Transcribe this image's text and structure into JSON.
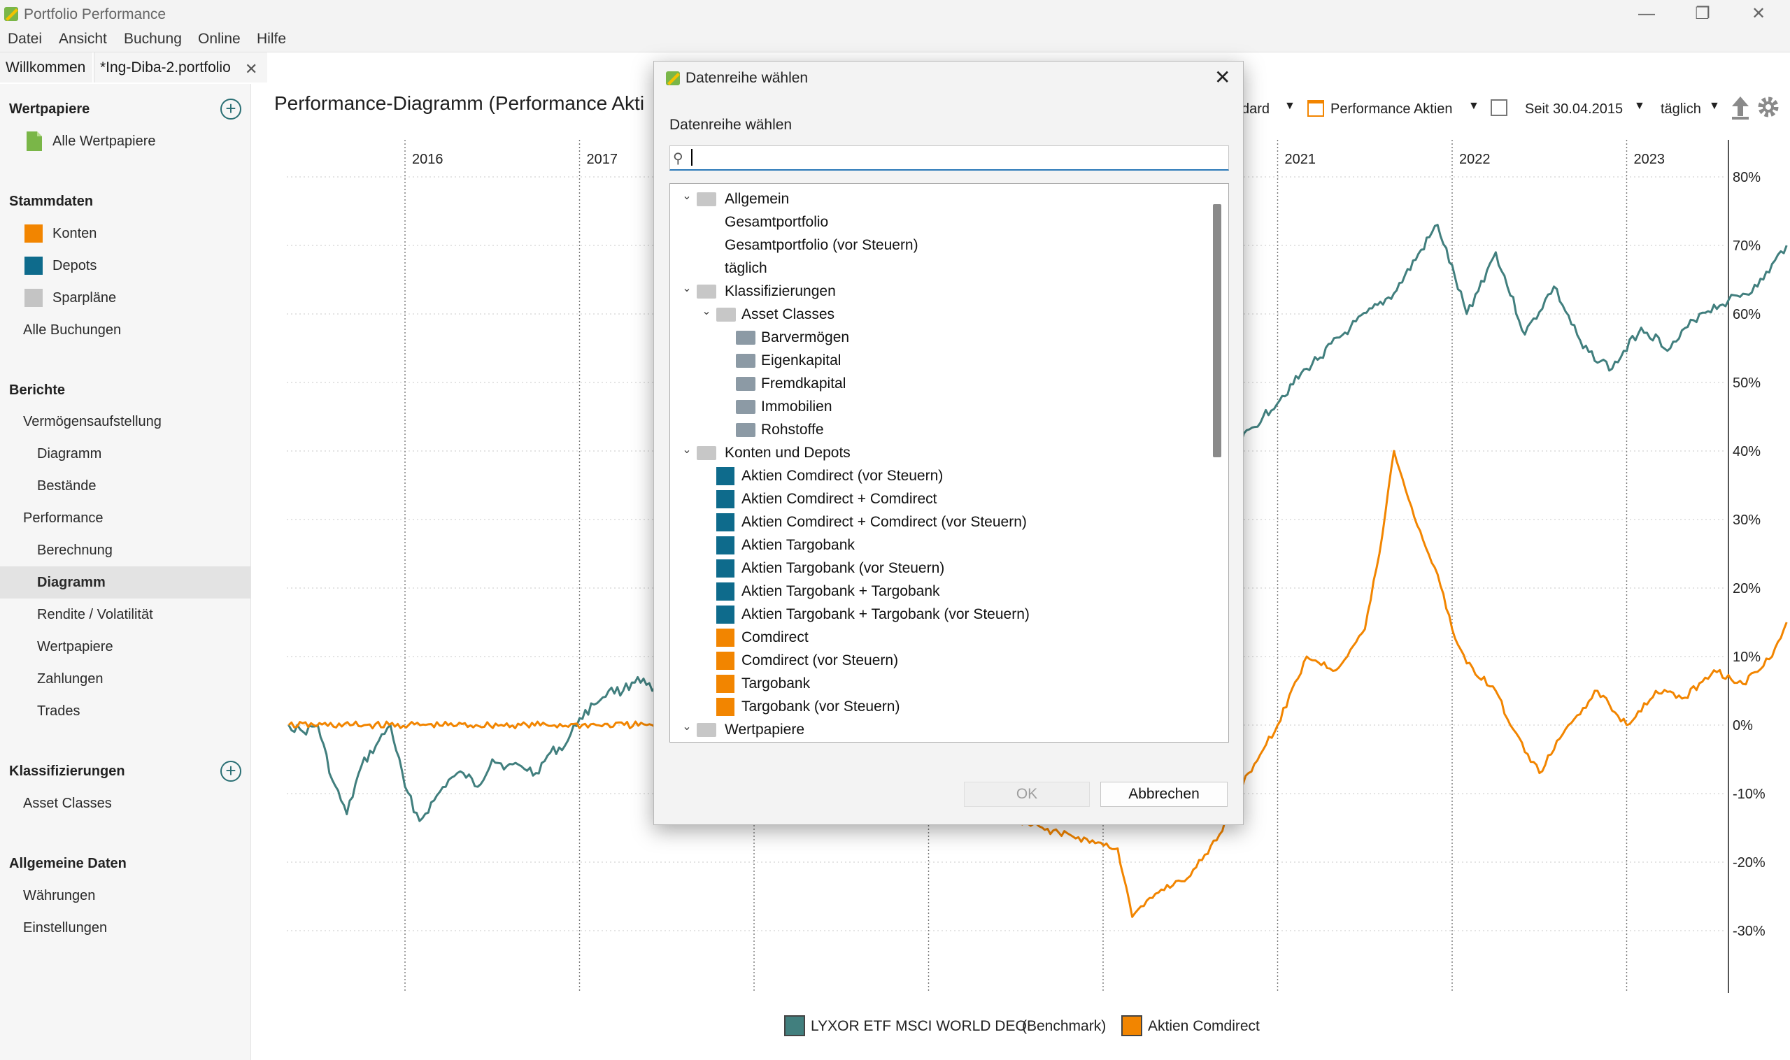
{
  "app": {
    "title": "Portfolio Performance"
  },
  "window": {
    "minimize": "—",
    "restore": "❐",
    "close": "✕"
  },
  "menu": [
    "Datei",
    "Ansicht",
    "Buchung",
    "Online",
    "Hilfe"
  ],
  "tabs": {
    "welcome": "Willkommen",
    "file": "*Ing-Diba-2.portfolio",
    "close": "✕"
  },
  "sidebar": {
    "wertpapiere": {
      "head": "Wertpapiere",
      "items": [
        "Alle Wertpapiere"
      ]
    },
    "stammdaten": {
      "head": "Stammdaten",
      "items": [
        "Konten",
        "Depots",
        "Sparpläne",
        "Alle Buchungen"
      ]
    },
    "berichte": {
      "head": "Berichte",
      "items": [
        "Vermögensaufstellung",
        "Diagramm",
        "Bestände",
        "Performance",
        "Berechnung",
        "Diagramm",
        "Rendite / Volatilität",
        "Wertpapiere",
        "Zahlungen",
        "Trades"
      ]
    },
    "klassifizierungen": {
      "head": "Klassifizierungen",
      "items": [
        "Asset Classes"
      ]
    },
    "allgemein": {
      "head": "Allgemeine Daten",
      "items": [
        "Währungen",
        "Einstellungen"
      ]
    },
    "active": "Diagramm"
  },
  "chart_header": {
    "title": "Performance-Diagramm (Performance Akti",
    "view_partial": "dard",
    "view_name": "Performance Aktien",
    "period": "Seit 30.04.2015",
    "interval": "täglich"
  },
  "colors": {
    "benchmark": "#417f7e",
    "aktien": "#f28500",
    "accent": "#2a6f74"
  },
  "chart_data": {
    "type": "line",
    "x_years": [
      "2016",
      "2017",
      "2021",
      "2022",
      "2023"
    ],
    "yticks": [
      "80%",
      "70%",
      "60%",
      "50%",
      "40%",
      "30%",
      "20%",
      "10%",
      "0%",
      "-10%",
      "-20%",
      "-30%"
    ],
    "ylim": [
      -30,
      80
    ],
    "grid": true,
    "legend_position": "bottom",
    "series": [
      {
        "name": "LYXOR ETF MSCI WORLD DEO",
        "suffix": "(Benchmark)",
        "color": "#417f7e",
        "points": [
          [
            "2015-05",
            0
          ],
          [
            "2015-06",
            -1
          ],
          [
            "2015-07",
            0
          ],
          [
            "2015-08",
            -8
          ],
          [
            "2015-09",
            -13
          ],
          [
            "2015-10",
            -6
          ],
          [
            "2015-11",
            -3
          ],
          [
            "2015-12",
            0
          ],
          [
            "2016-01",
            -9
          ],
          [
            "2016-02",
            -14
          ],
          [
            "2016-03",
            -11
          ],
          [
            "2016-04",
            -8
          ],
          [
            "2016-05",
            -7
          ],
          [
            "2016-06",
            -9
          ],
          [
            "2016-07",
            -5
          ],
          [
            "2016-08",
            -6
          ],
          [
            "2016-09",
            -6
          ],
          [
            "2016-10",
            -7
          ],
          [
            "2016-11",
            -4
          ],
          [
            "2016-12",
            -3
          ],
          [
            "2017-01",
            1
          ],
          [
            "2017-02",
            3
          ],
          [
            "2017-03",
            5
          ],
          [
            "2017-04",
            5
          ],
          [
            "2017-05",
            7
          ],
          [
            "2017-06",
            5
          ],
          [
            "2020-03",
            18
          ],
          [
            "2020-04",
            23
          ],
          [
            "2020-06",
            32
          ],
          [
            "2020-09",
            38
          ],
          [
            "2020-12",
            45
          ],
          [
            "2021-03",
            52
          ],
          [
            "2021-06",
            58
          ],
          [
            "2021-09",
            63
          ],
          [
            "2021-12",
            73
          ],
          [
            "2022-02",
            60
          ],
          [
            "2022-04",
            69
          ],
          [
            "2022-06",
            57
          ],
          [
            "2022-08",
            64
          ],
          [
            "2022-10",
            55
          ],
          [
            "2022-12",
            52
          ],
          [
            "2023-02",
            58
          ],
          [
            "2023-04",
            55
          ],
          [
            "2023-06",
            60
          ],
          [
            "2023-08",
            62
          ],
          [
            "2023-10",
            64
          ],
          [
            "2023-12",
            70
          ]
        ]
      },
      {
        "name": "Aktien Comdirect",
        "suffix": "",
        "color": "#f28500",
        "points": [
          [
            "2015-05",
            0
          ],
          [
            "2017-06",
            0
          ],
          [
            "2020-02",
            -18
          ],
          [
            "2020-03",
            -28
          ],
          [
            "2020-05",
            -24
          ],
          [
            "2020-07",
            -22
          ],
          [
            "2020-09",
            -16
          ],
          [
            "2020-11",
            -7
          ],
          [
            "2021-01",
            0
          ],
          [
            "2021-03",
            10
          ],
          [
            "2021-05",
            8
          ],
          [
            "2021-07",
            14
          ],
          [
            "2021-08",
            25
          ],
          [
            "2021-09",
            40
          ],
          [
            "2021-10",
            33
          ],
          [
            "2021-11",
            27
          ],
          [
            "2021-12",
            22
          ],
          [
            "2022-01",
            14
          ],
          [
            "2022-02",
            9
          ],
          [
            "2022-04",
            5
          ],
          [
            "2022-05",
            0
          ],
          [
            "2022-07",
            -7
          ],
          [
            "2022-09",
            0
          ],
          [
            "2022-11",
            5
          ],
          [
            "2023-01",
            0
          ],
          [
            "2023-03",
            5
          ],
          [
            "2023-05",
            4
          ],
          [
            "2023-07",
            8
          ],
          [
            "2023-09",
            6
          ],
          [
            "2023-11",
            10
          ],
          [
            "2023-12",
            15
          ]
        ]
      }
    ]
  },
  "dialog": {
    "title": "Datenreihe wählen",
    "label": "Datenreihe wählen",
    "search_placeholder": "",
    "ok": "OK",
    "cancel": "Abbrechen",
    "tree": [
      {
        "level": 0,
        "twisty": "⌄",
        "icon": "folder",
        "label": "Allgemein"
      },
      {
        "level": 1,
        "twisty": "",
        "icon": "",
        "label": "Gesamtportfolio"
      },
      {
        "level": 1,
        "twisty": "",
        "icon": "",
        "label": "Gesamtportfolio (vor Steuern)"
      },
      {
        "level": 1,
        "twisty": "",
        "icon": "",
        "label": "täglich"
      },
      {
        "level": 0,
        "twisty": "⌄",
        "icon": "folder",
        "label": "Klassifizierungen"
      },
      {
        "level": 1,
        "twisty": "⌄",
        "icon": "folder",
        "label": "Asset Classes"
      },
      {
        "level": 2,
        "twisty": "",
        "icon": "folder-dark",
        "label": "Barvermögen"
      },
      {
        "level": 2,
        "twisty": "",
        "icon": "folder-dark",
        "label": "Eigenkapital"
      },
      {
        "level": 2,
        "twisty": "",
        "icon": "folder-dark",
        "label": "Fremdkapital"
      },
      {
        "level": 2,
        "twisty": "",
        "icon": "folder-dark",
        "label": "Immobilien"
      },
      {
        "level": 2,
        "twisty": "",
        "icon": "folder-dark",
        "label": "Rohstoffe"
      },
      {
        "level": 0,
        "twisty": "⌄",
        "icon": "folder",
        "label": "Konten und Depots"
      },
      {
        "level": 1,
        "twisty": "",
        "icon": "depot",
        "label": "Aktien Comdirect (vor Steuern)"
      },
      {
        "level": 1,
        "twisty": "",
        "icon": "depot",
        "label": "Aktien Comdirect + Comdirect"
      },
      {
        "level": 1,
        "twisty": "",
        "icon": "depot",
        "label": "Aktien Comdirect + Comdirect (vor Steuern)"
      },
      {
        "level": 1,
        "twisty": "",
        "icon": "depot",
        "label": "Aktien Targobank"
      },
      {
        "level": 1,
        "twisty": "",
        "icon": "depot",
        "label": "Aktien Targobank (vor Steuern)"
      },
      {
        "level": 1,
        "twisty": "",
        "icon": "depot",
        "label": "Aktien Targobank + Targobank"
      },
      {
        "level": 1,
        "twisty": "",
        "icon": "depot",
        "label": "Aktien Targobank + Targobank (vor Steuern)"
      },
      {
        "level": 1,
        "twisty": "",
        "icon": "konto",
        "label": "Comdirect"
      },
      {
        "level": 1,
        "twisty": "",
        "icon": "konto",
        "label": "Comdirect (vor Steuern)"
      },
      {
        "level": 1,
        "twisty": "",
        "icon": "konto",
        "label": "Targobank"
      },
      {
        "level": 1,
        "twisty": "",
        "icon": "konto",
        "label": "Targobank (vor Steuern)"
      },
      {
        "level": 0,
        "twisty": "⌄",
        "icon": "folder",
        "label": "Wertpapiere"
      }
    ]
  }
}
